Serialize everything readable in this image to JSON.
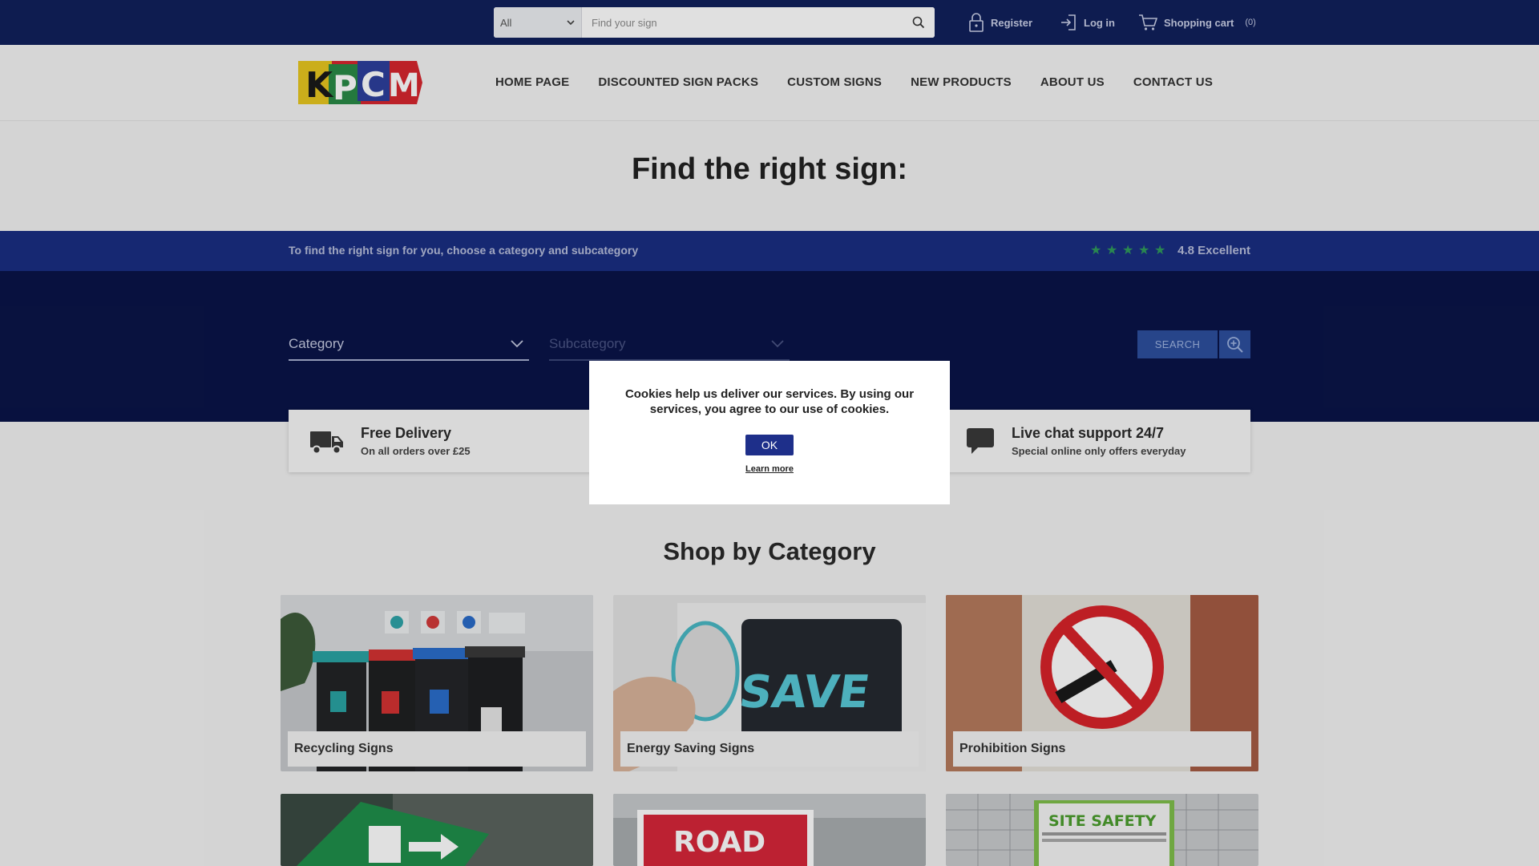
{
  "topbar": {
    "search_select_value": "All",
    "search_placeholder": "Find your sign",
    "register_label": "Register",
    "login_label": "Log in",
    "cart_label": "Shopping cart",
    "cart_count": "(0)"
  },
  "header": {
    "logo_text": "KPCM",
    "nav": [
      "HOME PAGE",
      "DISCOUNTED SIGN PACKS",
      "CUSTOM SIGNS",
      "NEW PRODUCTS",
      "ABOUT US",
      "CONTACT US"
    ]
  },
  "finder": {
    "title": "Find the right sign:",
    "instructions": "To find the right sign for you, choose a category and subcategory",
    "rating_text": "4.8 Excellent",
    "rating_stars": 5,
    "category_label": "Category",
    "subcategory_label": "Subcategory",
    "search_button": "SEARCH"
  },
  "features": [
    {
      "title": "Free Delivery",
      "subtitle": "On all orders over £25"
    },
    {
      "title": "Live chat support 24/7",
      "subtitle": "Special online only offers everyday"
    }
  ],
  "shop": {
    "title": "Shop by Category",
    "categories": [
      "Recycling Signs",
      "Energy Saving Signs",
      "Prohibition Signs"
    ],
    "partial_images": {
      "road": "ROAD",
      "site": "SITE SAFETY"
    }
  },
  "cookie": {
    "message": "Cookies help us deliver our services. By using our services, you agree to our use of cookies.",
    "ok_label": "OK",
    "learn_more": "Learn more"
  },
  "colors": {
    "topbar": "#10205c",
    "strip": "#1a2e82",
    "finder": "#0a1448",
    "button": "#1e2f8a",
    "star": "#2f9a5c"
  }
}
